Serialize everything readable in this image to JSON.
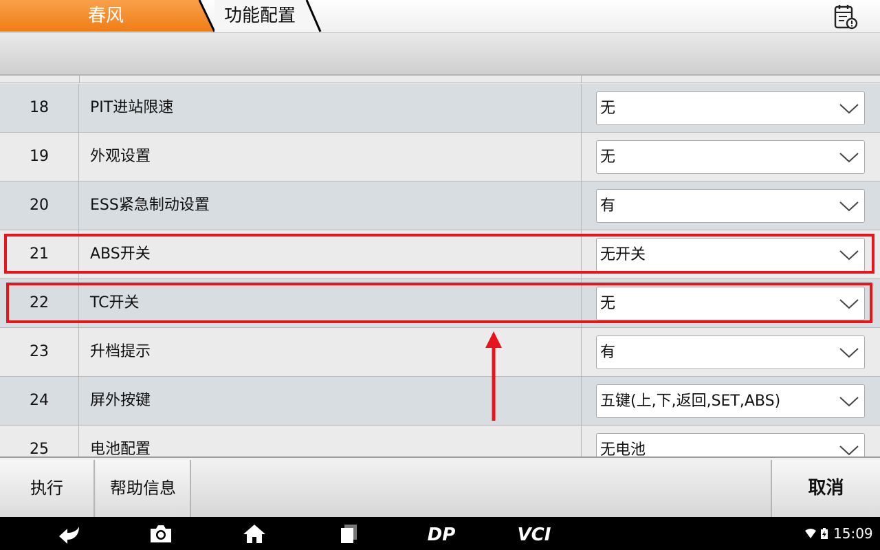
{
  "topbar": {
    "crumbs": [
      "春风",
      "功能配置"
    ],
    "report_icon": "clipboard-alert-icon",
    "accent_color": "#f5841f"
  },
  "table": {
    "rows": [
      {
        "num": "18",
        "label": "PIT进站限速",
        "value": "无"
      },
      {
        "num": "19",
        "label": "外观设置",
        "value": "无"
      },
      {
        "num": "20",
        "label": "ESS紧急制动设置",
        "value": "有"
      },
      {
        "num": "21",
        "label": "ABS开关",
        "value": "无开关"
      },
      {
        "num": "22",
        "label": "TC开关",
        "value": "无"
      },
      {
        "num": "23",
        "label": "升档提示",
        "value": "有"
      },
      {
        "num": "24",
        "label": "屏外按键",
        "value": "五键(上,下,返回,SET,ABS)"
      },
      {
        "num": "25",
        "label": "电池配置",
        "value": "无电池"
      }
    ],
    "highlight_color": "#e8141b"
  },
  "actions": {
    "execute": "执行",
    "help": "帮助信息",
    "cancel": "取消"
  },
  "navbar": {
    "icons": [
      "back-icon",
      "camera-icon",
      "home-icon",
      "recent-apps-icon",
      "dp-logo-icon",
      "vci-icon"
    ],
    "dp_label": "DP",
    "vci_label": "VCI",
    "time": "15:09"
  }
}
